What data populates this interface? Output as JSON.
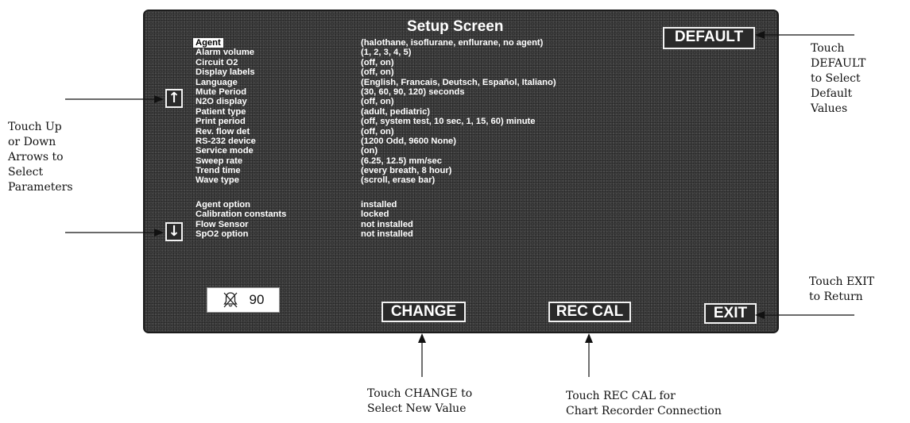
{
  "screen": {
    "title": "Setup Screen",
    "parameters": [
      {
        "name": "Agent",
        "values": "(halothane, isoflurane, enflurane, no agent)",
        "selected": true
      },
      {
        "name": "Alarm volume",
        "values": "(1, 2, 3, 4, 5)"
      },
      {
        "name": "Circuit O2",
        "values": "(off, on)"
      },
      {
        "name": "Display labels",
        "values": "(off, on)"
      },
      {
        "name": "Language",
        "values": "(English, Francais, Deutsch, Español, Italiano)"
      },
      {
        "name": "Mute Period",
        "values": "(30, 60, 90, 120) seconds"
      },
      {
        "name": "N2O display",
        "values": "(off, on)"
      },
      {
        "name": "Patient type",
        "values": "(adult, pediatric)"
      },
      {
        "name": "Print period",
        "values": "(off, system test, 10 sec, 1, 15, 60) minute"
      },
      {
        "name": "Rev. flow det",
        "values": "(off, on)"
      },
      {
        "name": "RS-232 device",
        "values": "(1200 Odd, 9600 None)"
      },
      {
        "name": "Service mode",
        "values": "(on)"
      },
      {
        "name": "Sweep rate",
        "values": "(6.25, 12.5) mm/sec"
      },
      {
        "name": "Trend time",
        "values": "(every breath, 8 hour)"
      },
      {
        "name": "Wave type",
        "values": "(scroll, erase bar)"
      }
    ],
    "options": [
      {
        "name": "Agent option",
        "value": "installed"
      },
      {
        "name": "Calibration constants",
        "value": "locked"
      },
      {
        "name": "Flow Sensor",
        "value": "not installed"
      },
      {
        "name": "SpO2 option",
        "value": "not installed"
      }
    ],
    "up_arrow": "↑",
    "down_arrow": "↓",
    "alarm_silence": {
      "icon": "alarm-silenced-bell-icon",
      "value": "90"
    },
    "buttons": {
      "default": "DEFAULT",
      "change": "CHANGE",
      "rec_cal": "REC CAL",
      "exit": "EXIT"
    }
  },
  "callouts": {
    "default": [
      "Touch",
      "DEFAULT",
      "to Select",
      "Default",
      "Values"
    ],
    "arrows": [
      "Touch Up",
      "or Down",
      "Arrows to",
      "Select",
      "Parameters"
    ],
    "exit": [
      "Touch EXIT",
      "to Return"
    ],
    "change": [
      "Touch CHANGE to",
      "Select New Value"
    ],
    "rec_cal": [
      "Touch REC CAL for",
      "Chart Recorder Connection"
    ]
  },
  "colors": {
    "screen_background": "#3e3e3e",
    "screen_text": "#ffffff",
    "page_background": "#ffffff"
  }
}
